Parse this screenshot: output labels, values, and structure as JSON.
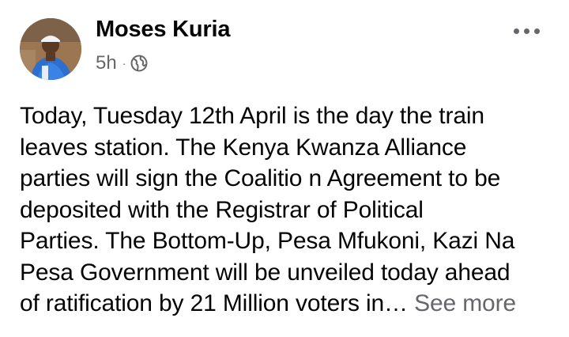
{
  "post": {
    "author": "Moses Kuria",
    "time": "5h",
    "separator": "·",
    "privacy_icon": "globe-icon",
    "menu_icon": "more-dots-icon",
    "text_lines": [
      "Today, Tuesday 12th April is the day the train",
      "leaves station. The Kenya Kwanza Alliance",
      "parties will sign the Coalitio n Agreement to be",
      "deposited with the Registrar of Political",
      "Parties. The Bottom-Up, Pesa Mfukoni, Kazi Na",
      "Pesa Government will be unveiled today ahead",
      "of ratification by 21 Million voters in…"
    ],
    "see_more": "See more"
  },
  "colors": {
    "text_primary": "#050505",
    "text_secondary": "#65676b",
    "background": "#ffffff"
  }
}
